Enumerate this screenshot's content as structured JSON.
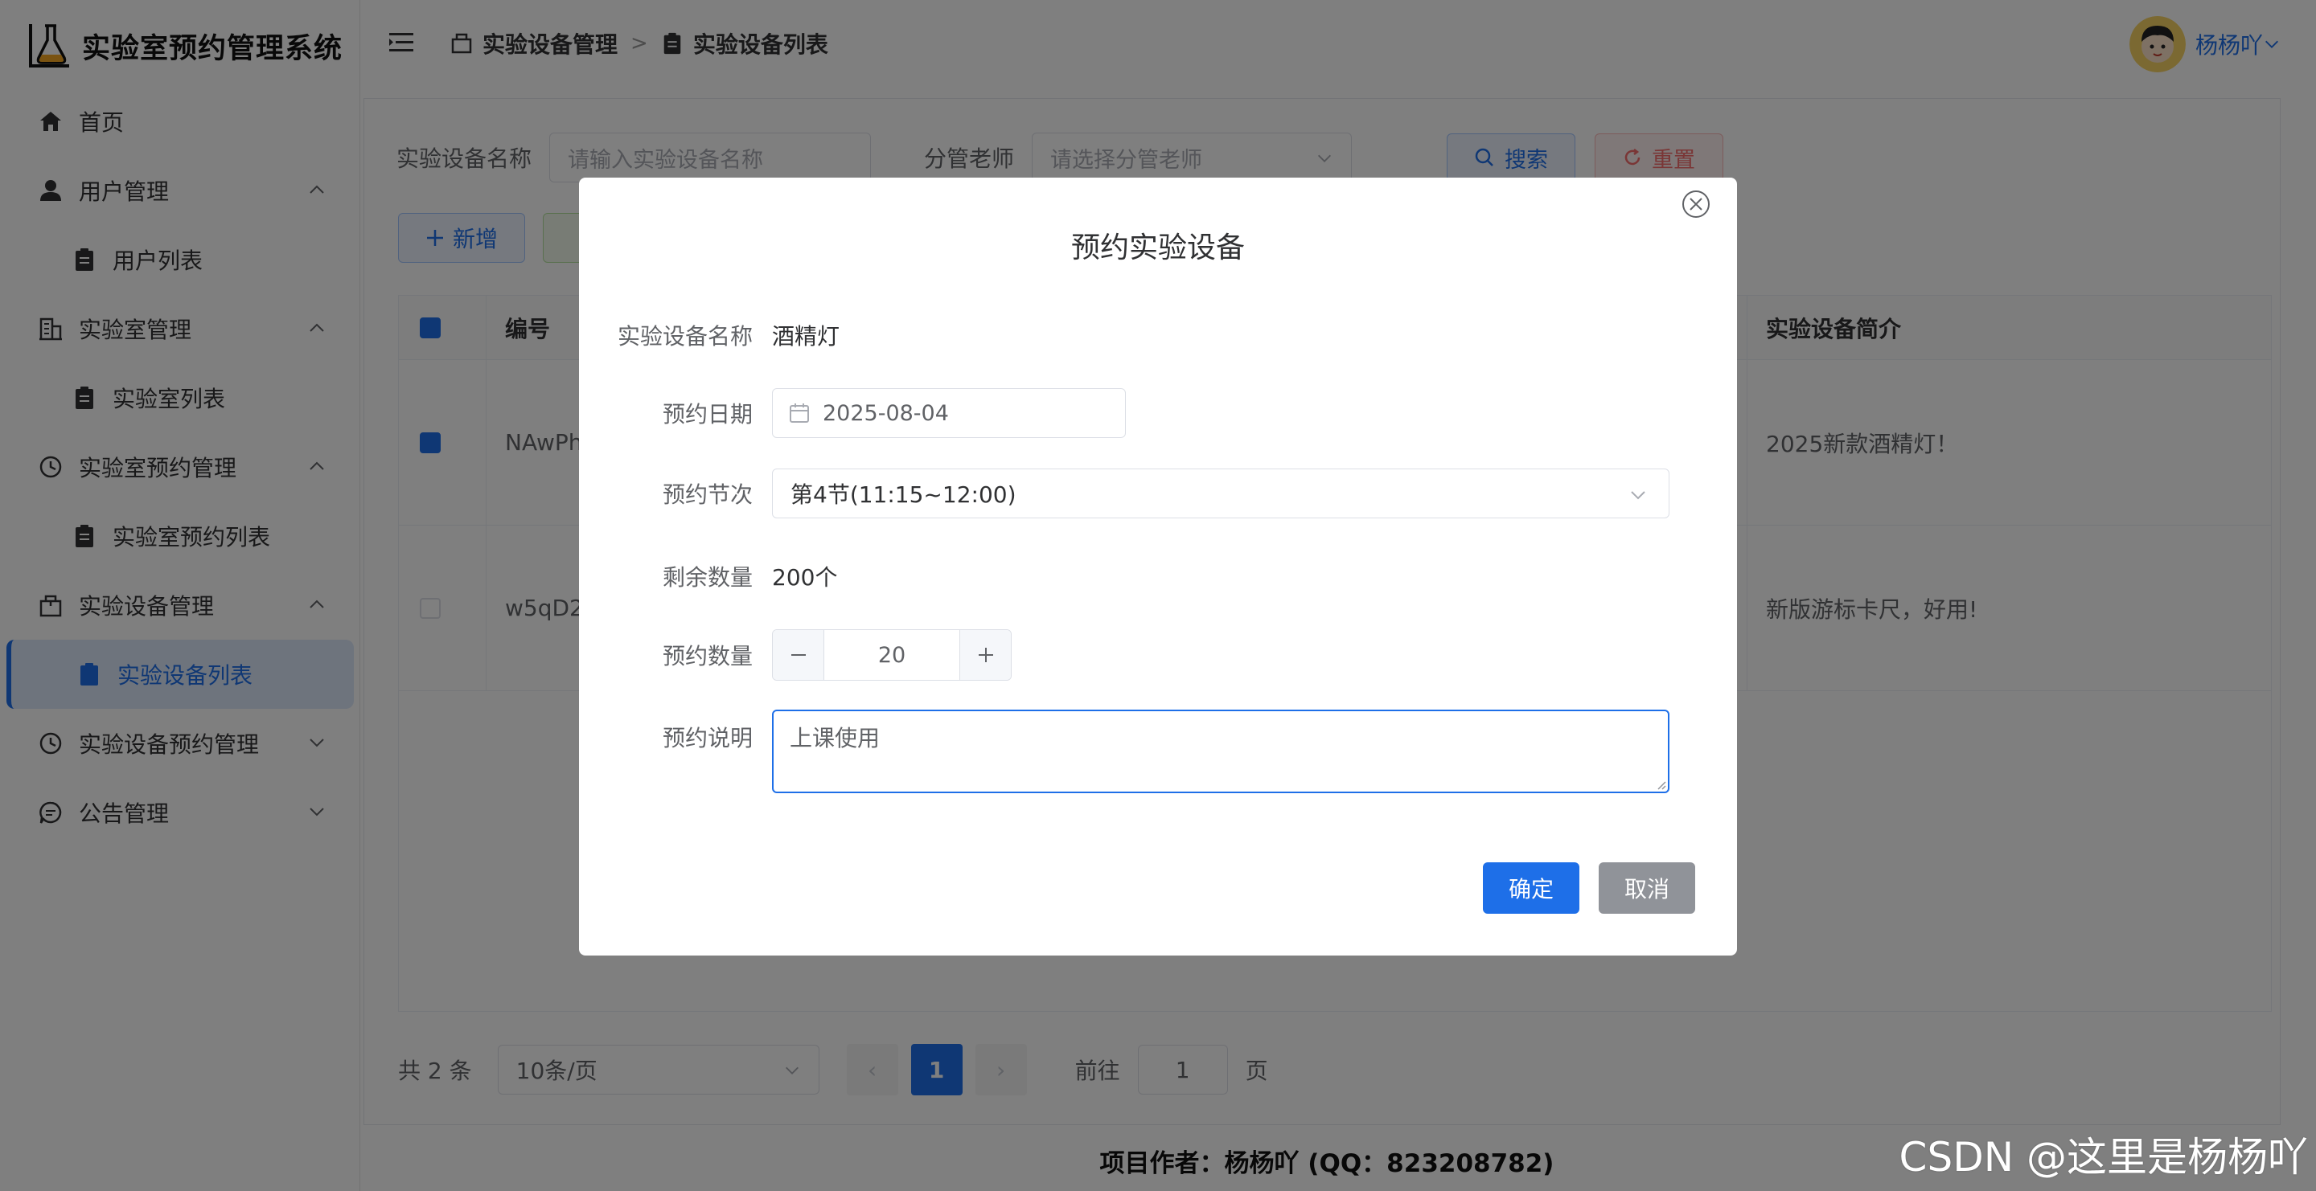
{
  "app": {
    "title": "实验室预约管理系统"
  },
  "sidebar": {
    "items": [
      {
        "label": "首页"
      },
      {
        "label": "用户管理"
      },
      {
        "label": "用户列表"
      },
      {
        "label": "实验室管理"
      },
      {
        "label": "实验室列表"
      },
      {
        "label": "实验室预约管理"
      },
      {
        "label": "实验室预约列表"
      },
      {
        "label": "实验设备管理"
      },
      {
        "label": "实验设备列表"
      },
      {
        "label": "实验设备预约管理"
      },
      {
        "label": "公告管理"
      }
    ]
  },
  "header": {
    "breadcrumb": [
      "实验设备管理",
      "实验设备列表"
    ],
    "separator": ">",
    "username": "杨杨吖"
  },
  "filter": {
    "name_label": "实验设备名称",
    "name_placeholder": "请输入实验设备名称",
    "teacher_label": "分管老师",
    "teacher_placeholder": "请选择分管老师",
    "search_label": "搜索",
    "reset_label": "重置"
  },
  "toolbar": {
    "add_label": "新增"
  },
  "table": {
    "headers": {
      "id": "编号",
      "desc": "实验设备简介"
    },
    "rows": [
      {
        "id": "NAwPh",
        "desc": "2025新款酒精灯！",
        "checked": true
      },
      {
        "id": "w5qD2",
        "desc": "新版游标卡尺，好用!",
        "checked": false
      }
    ]
  },
  "pager": {
    "total": "共 2 条",
    "page_size": "10条/页",
    "current": "1",
    "goto_label": "前往",
    "goto_value": "1",
    "page_suffix": "页",
    "prev": "‹",
    "next": "›"
  },
  "dialog": {
    "title": "预约实验设备",
    "fields": {
      "name_label": "实验设备名称",
      "name_value": "酒精灯",
      "date_label": "预约日期",
      "date_value": "2025-08-04",
      "period_label": "预约节次",
      "period_value": "第4节(11:15~12:00)",
      "remain_label": "剩余数量",
      "remain_value": "200个",
      "qty_label": "预约数量",
      "qty_value": "20",
      "note_label": "预约说明",
      "note_value": "上课使用"
    },
    "confirm_label": "确定",
    "cancel_label": "取消"
  },
  "footer": {
    "text": "项目作者：杨杨吖 (QQ：823208782)"
  },
  "watermark": {
    "text": "CSDN @这里是杨杨吖"
  },
  "colors": {
    "primary": "#1e6fe8",
    "danger": "#f56c6c",
    "overlay": "rgba(0,0,0,0.5)"
  }
}
